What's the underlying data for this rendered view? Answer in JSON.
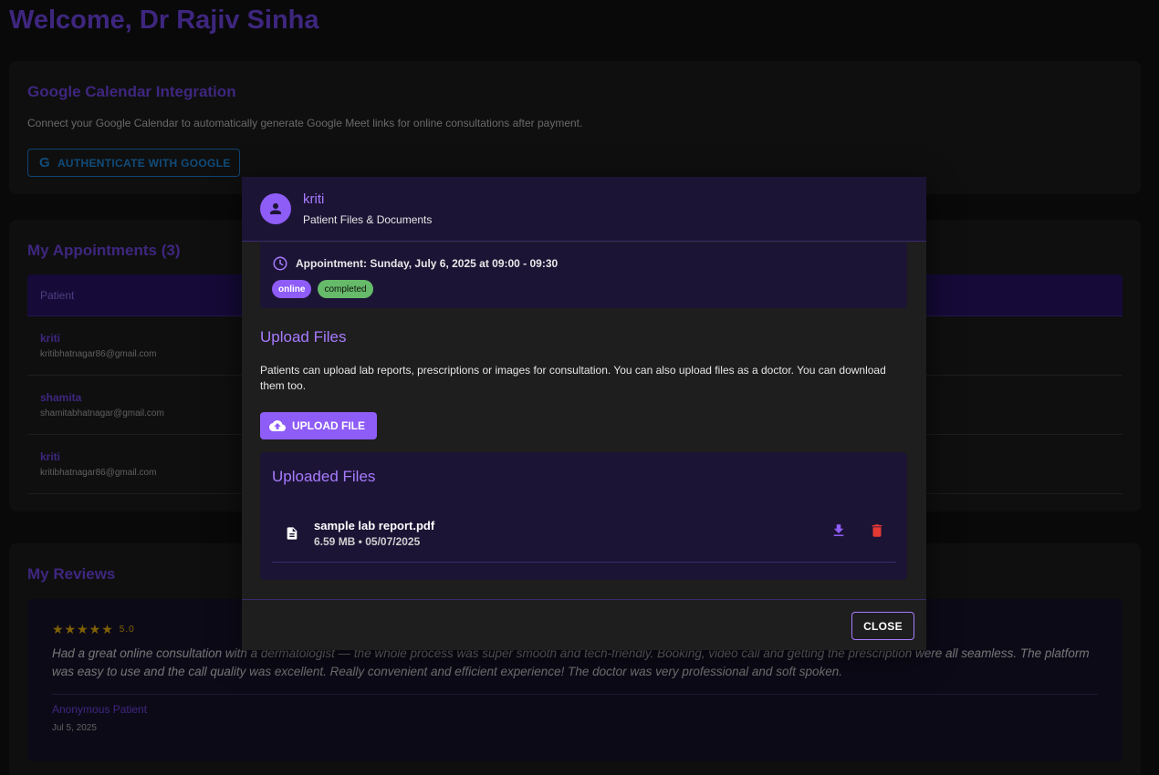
{
  "page": {
    "title": "Welcome, Dr Rajiv Sinha"
  },
  "calendar": {
    "title": "Google Calendar Integration",
    "description": "Connect your Google Calendar to automatically generate Google Meet links for online consultations after payment.",
    "auth_button": "AUTHENTICATE WITH GOOGLE",
    "icon": "google-icon"
  },
  "appointments": {
    "title": "My Appointments (3)",
    "columns": [
      "Patient"
    ],
    "rows": [
      {
        "name": "kriti",
        "email": "kritibhatnagar86@gmail.com"
      },
      {
        "name": "shamita",
        "email": "shamitabhatnagar@gmail.com"
      },
      {
        "name": "kriti",
        "email": "kritibhatnagar86@gmail.com"
      }
    ]
  },
  "reviews": {
    "title": "My Reviews",
    "items": [
      {
        "stars": "★★★★★",
        "rating": "5.0",
        "text": "Had a great online consultation with a dermatologist — the whole process was super smooth and tech-friendly. Booking, video call and getting the prescription were all seamless. The platform was easy to use and the call quality was excellent. Really convenient and efficient experience! The doctor was very professional and soft spoken.",
        "author": "Anonymous Patient",
        "date": "Jul 5, 2025"
      }
    ]
  },
  "modal": {
    "patient_name": "kriti",
    "subtitle": "Patient Files & Documents",
    "appointment_text": "Appointment: Sunday, July 6, 2025 at 09:00 - 09:30",
    "chips": {
      "mode": "online",
      "status": "completed"
    },
    "upload": {
      "title": "Upload Files",
      "description": "Patients can upload lab reports, prescriptions or images for consultation. You can also upload files as a doctor. You can download them too.",
      "button": "UPLOAD FILE"
    },
    "uploaded": {
      "title": "Uploaded Files",
      "files": [
        {
          "name": "sample lab report.pdf",
          "info": "6.59 MB • 05/07/2025"
        }
      ]
    },
    "close_button": "CLOSE"
  },
  "colors": {
    "accent": "#8e5cf7",
    "accent_text": "#a77bff",
    "google_blue": "#2196f3",
    "success": "#66bb6a",
    "danger": "#e53935",
    "star": "#ffc107"
  }
}
